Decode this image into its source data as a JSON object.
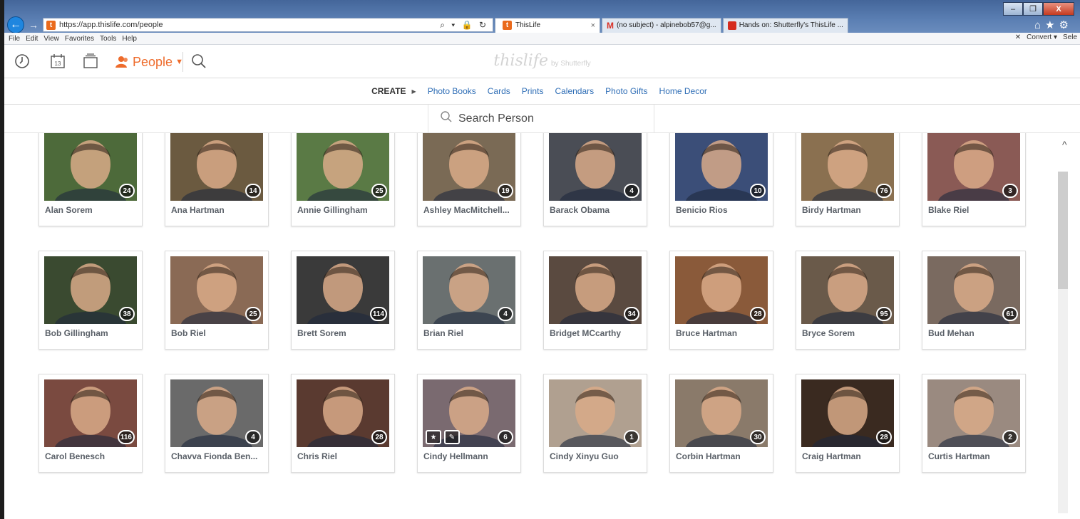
{
  "browser": {
    "url": "https://app.thislife.com/people",
    "address_tools": "⌕ ▾ 🔒 ↻",
    "tabs": [
      {
        "label": "ThisLife",
        "active": true
      },
      {
        "label": "(no subject) - alpinebob57@g...",
        "active": false
      },
      {
        "label": "Hands on: Shutterfly's ThisLife ...",
        "active": false
      }
    ],
    "menu": [
      "File",
      "Edit",
      "View",
      "Favorites",
      "Tools",
      "Help"
    ],
    "toolbar_right": [
      "✕",
      "Convert ▾",
      "Sele"
    ],
    "window_controls": [
      "–",
      "❐",
      "X"
    ]
  },
  "app": {
    "calendar_day": "13",
    "people_label": "People",
    "logo_text": "thislife",
    "logo_sub": "by Shutterfly",
    "create_label": "CREATE",
    "create_links": [
      "Photo Books",
      "Cards",
      "Prints",
      "Calendars",
      "Photo Gifts",
      "Home Decor"
    ],
    "search_placeholder": "Search Person"
  },
  "people": [
    {
      "name": "Alan Sorem",
      "count": "24"
    },
    {
      "name": "Ana Hartman",
      "count": "14"
    },
    {
      "name": "Annie Gillingham",
      "count": "25"
    },
    {
      "name": "Ashley MacMitchell...",
      "count": "19"
    },
    {
      "name": "Barack Obama",
      "count": "4"
    },
    {
      "name": "Benicio Rios",
      "count": "10"
    },
    {
      "name": "Birdy Hartman",
      "count": "76"
    },
    {
      "name": "Blake Riel",
      "count": "3"
    },
    {
      "name": "Bob Gillingham",
      "count": "38"
    },
    {
      "name": "Bob Riel",
      "count": "25"
    },
    {
      "name": "Brett Sorem",
      "count": "114"
    },
    {
      "name": "Brian Riel",
      "count": "4"
    },
    {
      "name": "Bridget MCcarthy",
      "count": "34"
    },
    {
      "name": "Bruce Hartman",
      "count": "28"
    },
    {
      "name": "Bryce Sorem",
      "count": "95"
    },
    {
      "name": "Bud Mehan",
      "count": "61"
    },
    {
      "name": "Carol Benesch",
      "count": "116"
    },
    {
      "name": "Chavva Fionda Ben...",
      "count": "4"
    },
    {
      "name": "Chris Riel",
      "count": "28"
    },
    {
      "name": "Cindy Hellmann",
      "count": "6"
    },
    {
      "name": "Cindy Xinyu Guo",
      "count": "1"
    },
    {
      "name": "Corbin Hartman",
      "count": "30"
    },
    {
      "name": "Craig Hartman",
      "count": "28"
    },
    {
      "name": "Curtis Hartman",
      "count": "2"
    }
  ],
  "colors": {
    "accent": "#ee6b2b",
    "link": "#2f6eb6",
    "photo_backgrounds": [
      "#4d6a3a",
      "#6b5a40",
      "#5a7a45",
      "#7a6a55",
      "#4a4d55",
      "#3b4e78",
      "#8a7050",
      "#8a5a55",
      "#3a4a30",
      "#8a6a55",
      "#3a3a3a",
      "#6a7070",
      "#5a4a40",
      "#8a5a3a",
      "#6a5a4a",
      "#7a6a60",
      "#7a4a40",
      "#6a6a6a",
      "#5a3a30",
      "#7a6a70",
      "#b0a090",
      "#8a7a6a",
      "#3a2a20",
      "#9a8a80"
    ]
  }
}
